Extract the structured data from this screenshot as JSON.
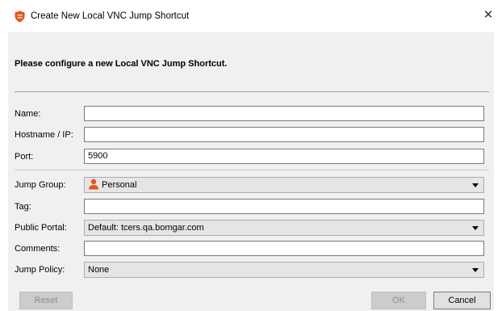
{
  "window": {
    "title": "Create New Local VNC Jump Shortcut",
    "close_glyph": "✕",
    "app_icon": "shield-icon",
    "accent_color": "#e8531d"
  },
  "form": {
    "instructions": "Please configure a new Local VNC Jump Shortcut.",
    "name": {
      "label": "Name:",
      "value": ""
    },
    "hostname": {
      "label": "Hostname / IP:",
      "value": ""
    },
    "port": {
      "label": "Port:",
      "value": "5900"
    },
    "jump_group": {
      "label": "Jump Group:",
      "value": "Personal",
      "icon": "person-icon"
    },
    "tag": {
      "label": "Tag:",
      "value": ""
    },
    "public_portal": {
      "label": "Public Portal:",
      "value": "Default: tcers.qa.bomgar.com"
    },
    "comments": {
      "label": "Comments:",
      "value": ""
    },
    "jump_policy": {
      "label": "Jump Policy:",
      "value": "None"
    }
  },
  "buttons": {
    "reset": "Reset",
    "ok": "OK",
    "cancel": "Cancel"
  }
}
